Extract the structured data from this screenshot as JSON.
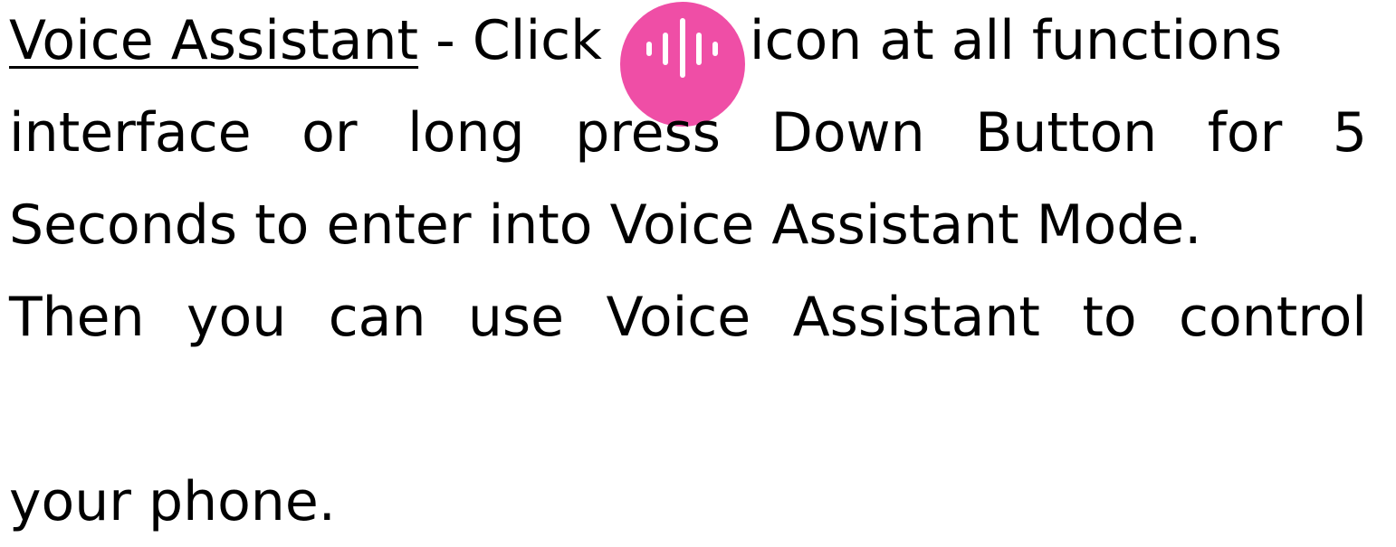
{
  "colors": {
    "accent": "#ef4ea6",
    "text": "#000000"
  },
  "icon": "voice-waveform-icon",
  "paragraph": {
    "heading": "Voice Assistant",
    "line1_after_heading": " - Click",
    "line1_after_icon": "icon at all functions",
    "line2_words": [
      "interface",
      "or",
      "long",
      "press",
      "Down",
      "Button",
      "for",
      "5"
    ],
    "line3": "Seconds to enter into Voice Assistant Mode.",
    "line4_words": [
      "Then",
      "you",
      "can",
      "use",
      "Voice",
      "Assistant",
      "to",
      "control"
    ],
    "line5": "your phone."
  }
}
